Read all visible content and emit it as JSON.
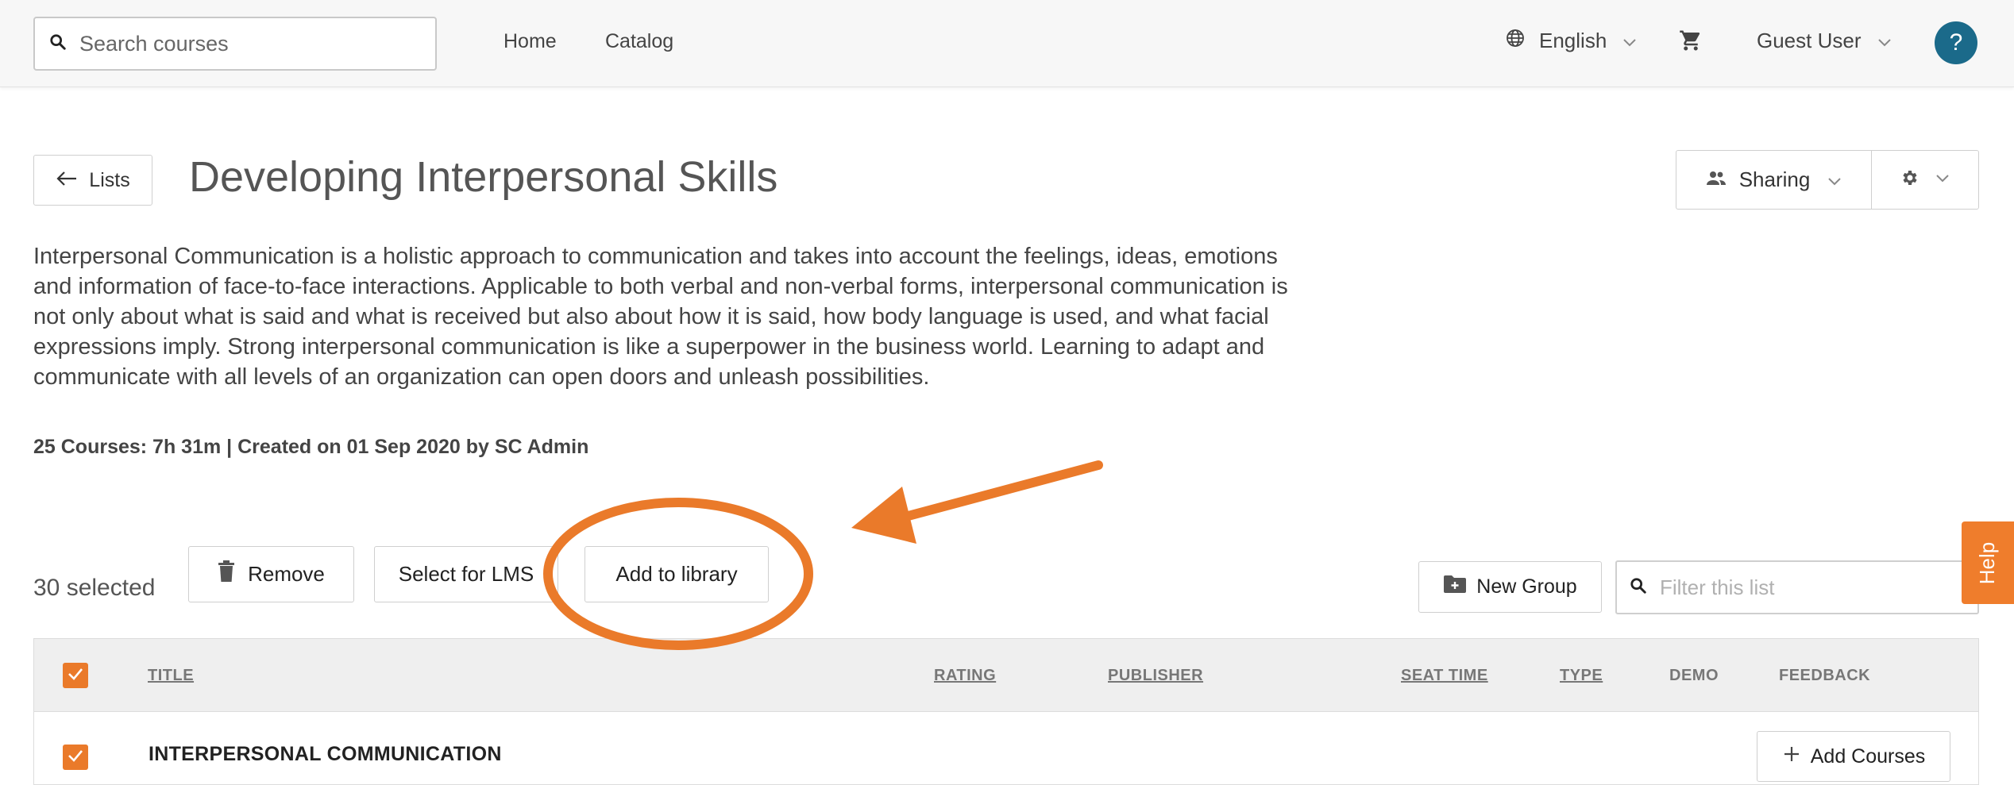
{
  "header": {
    "search_placeholder": "Search courses",
    "nav": [
      {
        "label": "Home"
      },
      {
        "label": "Catalog"
      }
    ],
    "language": "English",
    "user": "Guest User",
    "help_glyph": "?"
  },
  "page": {
    "back_label": "Lists",
    "title": "Developing Interpersonal Skills",
    "sharing_label": "Sharing",
    "description": "Interpersonal Communication is a holistic approach to communication and takes into account the feelings, ideas, emotions and information of face-to-face interactions. Applicable to both verbal and non-verbal forms, interpersonal communication is not only about what is said and what is received but also about how it is said, how body language is used, and what facial expressions imply. Strong interpersonal communication is like a superpower in the business world. Learning to adapt and communicate with all levels of an organization can open doors and unleash possibilities.",
    "meta": "25 Courses: 7h 31m | Created on 01 Sep 2020 by SC Admin"
  },
  "toolbar": {
    "selected_count": "30 selected",
    "remove_label": "Remove",
    "select_lms_label": "Select for LMS",
    "add_library_label": "Add to library",
    "new_group_label": "New Group",
    "filter_placeholder": "Filter this list"
  },
  "table": {
    "columns": [
      "TITLE",
      "RATING",
      "PUBLISHER",
      "SEAT TIME",
      "TYPE",
      "DEMO",
      "FEEDBACK"
    ],
    "rows": [
      {
        "title": "INTERPERSONAL COMMUNICATION",
        "action": "Add Courses"
      }
    ]
  },
  "help_tab_label": "Help",
  "colors": {
    "accent": "#ea7a2a",
    "help_circle": "#1b6a8a"
  },
  "icons": [
    "search-icon",
    "globe-icon",
    "chevron-down-icon",
    "cart-icon",
    "arrow-left-icon",
    "people-icon",
    "gear-icon",
    "trash-icon",
    "folder-plus-icon",
    "check-icon",
    "plus-icon"
  ]
}
